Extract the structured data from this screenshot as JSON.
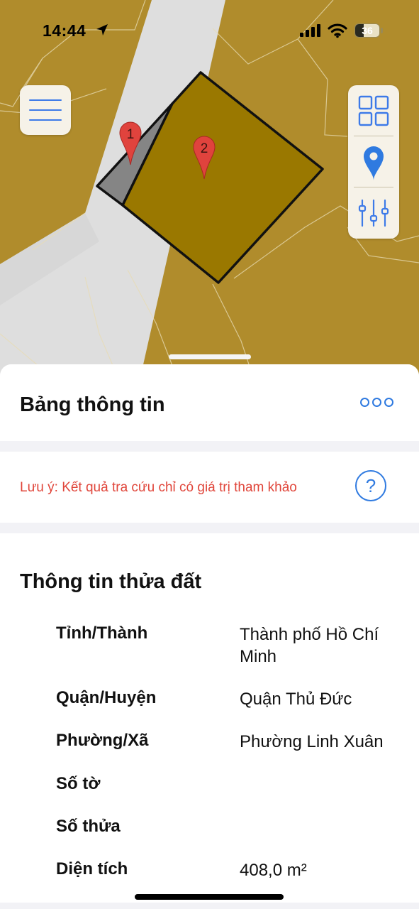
{
  "status_bar": {
    "time": "14:44",
    "battery": "36",
    "battery_level": 0.36
  },
  "map": {
    "icons": {
      "menu": "hamburger-menu-icon",
      "layers": "grid-layers-icon",
      "location": "location-pin-icon",
      "filter": "sliders-icon"
    },
    "markers": [
      {
        "label": "1"
      },
      {
        "label": "2"
      }
    ],
    "colors": {
      "land": "#b08c2c",
      "road": "#dedede",
      "parcel_main": "#9a7800",
      "parcel_small": "#8a8a8a",
      "marker": "#e0433d"
    }
  },
  "panel": {
    "title": "Bảng thông tin",
    "more_icon": "more-dots-icon",
    "note": "Lưu ý: Kết quả tra cứu chỉ có giá trị tham khảo",
    "help_icon": "question-mark-icon",
    "help_label": "?",
    "section_title": "Thông tin thửa đất",
    "rows": [
      {
        "label": "Tỉnh/Thành",
        "value": "Thành phố Hồ Chí Minh"
      },
      {
        "label": "Quận/Huyện",
        "value": "Quận Thủ Đức"
      },
      {
        "label": "Phường/Xã",
        "value": "Phường Linh Xuân"
      },
      {
        "label": "Số tờ",
        "value": ""
      },
      {
        "label": "Số thửa",
        "value": ""
      },
      {
        "label": "Diện tích",
        "value": "408,0 m²"
      }
    ]
  },
  "colors": {
    "accent": "#2f7ae0",
    "warning": "#e0453a"
  }
}
